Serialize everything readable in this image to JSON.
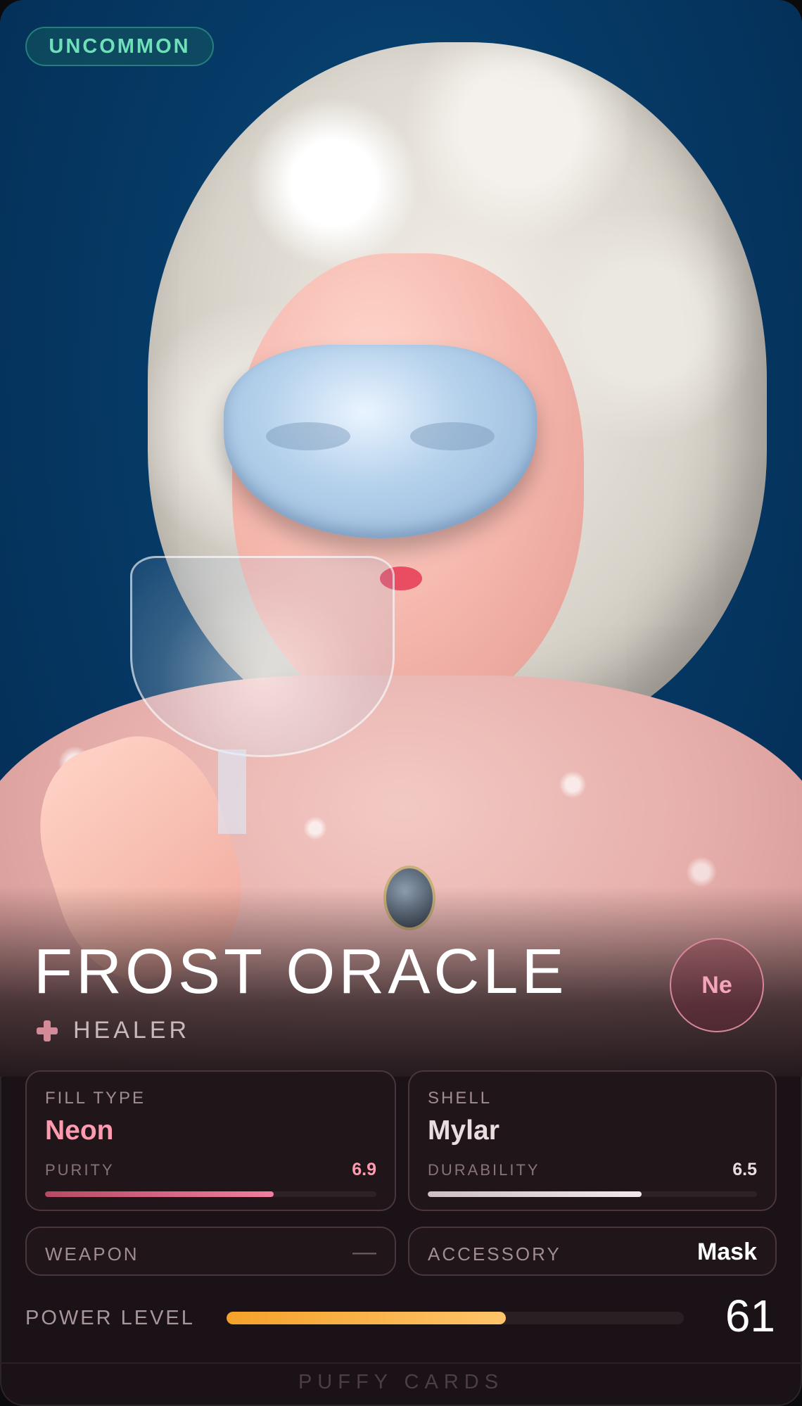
{
  "card": {
    "rarity": "UNCOMMON",
    "name": "FROST ORACLE",
    "role": "HEALER",
    "role_icon": "plus-icon",
    "element": "Ne",
    "fill": {
      "label": "FILL TYPE",
      "value": "Neon",
      "sub_label": "PURITY",
      "sub_value": "6.9",
      "bar_fraction": 0.69
    },
    "shell": {
      "label": "SHELL",
      "value": "Mylar",
      "sub_label": "DURABILITY",
      "sub_value": "6.5",
      "bar_fraction": 0.65
    },
    "weapon": {
      "label": "WEAPON",
      "value": "—"
    },
    "accessory": {
      "label": "ACCESSORY",
      "value": "Mask"
    },
    "power": {
      "label": "POWER LEVEL",
      "value": "61",
      "bar_fraction": 0.61
    },
    "footer": "PUFFY CARDS"
  },
  "colors": {
    "rarity_accent": "#6fe0b9",
    "element_accent": "#f3a6b8",
    "fill_accent": "#ff9bb1",
    "power_accent": "#f4a22a",
    "background": "#1a1216"
  }
}
